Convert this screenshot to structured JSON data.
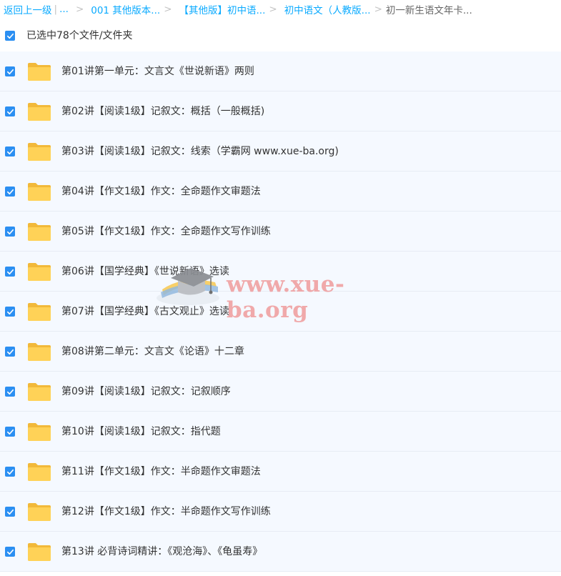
{
  "breadcrumb": {
    "back_label": "返回上一级",
    "bar": "|",
    "ellipsis": "...",
    "separator": ">",
    "crumbs": [
      "001 其他版本...",
      "【其他版】初中语...",
      "初中语文（人教版...",
      "初一新生语文年卡..."
    ]
  },
  "selection": {
    "text": "已选中78个文件/文件夹",
    "checked": true
  },
  "files": [
    {
      "name": "第01讲第一单元：文言文《世说新语》两则"
    },
    {
      "name": "第02讲【阅读1级】记叙文：概括（一般概括)"
    },
    {
      "name": "第03讲【阅读1级】记叙文：线索（学霸网 www.xue-ba.org)"
    },
    {
      "name": "第04讲【作文1级】作文：全命题作文审题法"
    },
    {
      "name": "第05讲【作文1级】作文：全命题作文写作训练"
    },
    {
      "name": "第06讲【国学经典】《世说新语》选读"
    },
    {
      "name": "第07讲【国学经典】《古文观止》选读"
    },
    {
      "name": "第08讲第二单元：文言文《论语》十二章"
    },
    {
      "name": "第09讲【阅读1级】记叙文：记叙顺序"
    },
    {
      "name": "第10讲【阅读1级】记叙文：指代题"
    },
    {
      "name": "第11讲【作文1级】作文：半命题作文审题法"
    },
    {
      "name": "第12讲【作文1级】作文：半命题作文写作训练"
    },
    {
      "name": "第13讲 必背诗词精讲：《观沧海》、《龟虽寿》"
    }
  ],
  "watermark": {
    "text": "www.xue-ba.org"
  },
  "colors": {
    "accent": "#09aaff",
    "checkbox": "#2b8ff2",
    "row_bg": "#f5f9ff",
    "folder": "#ffd257"
  },
  "icons": {
    "checkbox": "checkmark-icon",
    "folder": "folder-icon",
    "watermark_logo": "graduation-cap-icon"
  }
}
